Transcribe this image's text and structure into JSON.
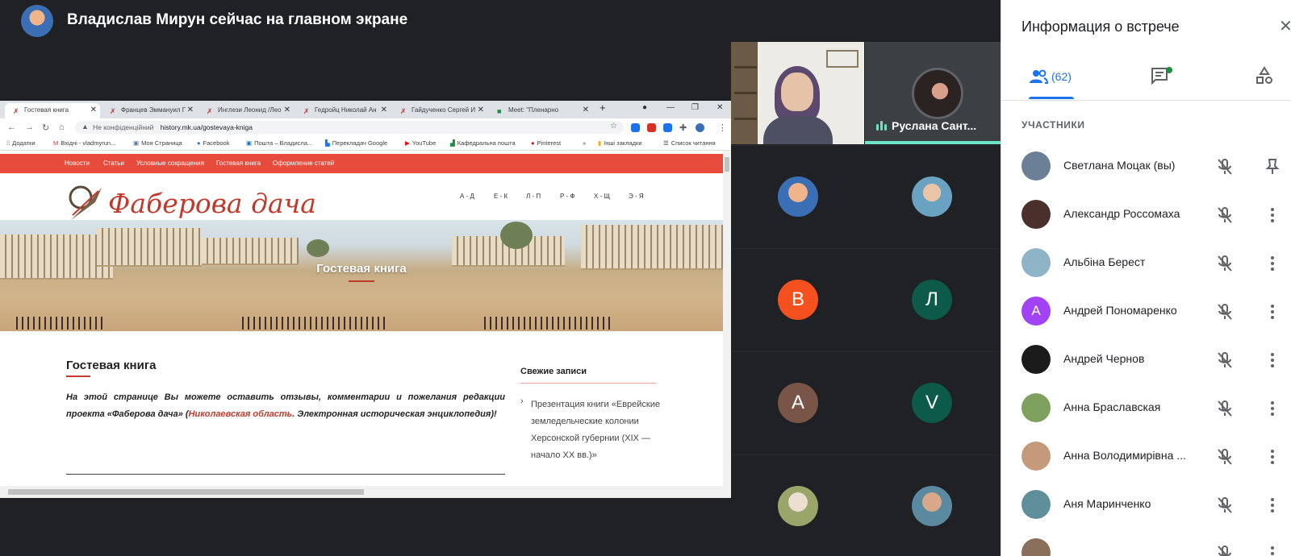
{
  "meeting": {
    "presenter_text": "Владислав Мирун сейчас на главном экране"
  },
  "browser": {
    "tabs": [
      {
        "label": "Гостевая книга",
        "active": true
      },
      {
        "label": "Францев Эммануил Г",
        "active": false
      },
      {
        "label": "Инглези Леонид /Лео",
        "active": false
      },
      {
        "label": "Гедройц Николай Ан",
        "active": false
      },
      {
        "label": "Гайдученко Сергей И",
        "active": false
      },
      {
        "label": "Meet: \"Пленарно",
        "active": false
      }
    ],
    "new_tab": "+",
    "security_label": "Не конфіденційний",
    "url": "history.mk.ua/gostevaya-kniga",
    "bookmarks": [
      {
        "label": "Додатки",
        "icon": "apps-icon"
      },
      {
        "label": "Вхідні - vladmyrun...",
        "icon": "gmail-icon"
      },
      {
        "label": "Моя Страница",
        "icon": "vk-icon"
      },
      {
        "label": "Facebook",
        "icon": "facebook-icon"
      },
      {
        "label": "Пошта – Владисла...",
        "icon": "outlook-icon"
      },
      {
        "label": "Перекладач Google",
        "icon": "translate-icon"
      },
      {
        "label": "YouTube",
        "icon": "youtube-icon"
      },
      {
        "label": "Кафедральна пошта",
        "icon": "mail-icon"
      },
      {
        "label": "Pinterest",
        "icon": "pinterest-icon"
      },
      {
        "label": "»",
        "icon": "more-icon"
      },
      {
        "label": "Інші закладки",
        "icon": "folder-icon"
      },
      {
        "label": "Список читання",
        "icon": "reading-list-icon"
      }
    ]
  },
  "site": {
    "nav": [
      "Новости",
      "Статьи",
      "Условные сокращения",
      "Гостевая книга",
      "Оформление статей"
    ],
    "logo_text": "Фаберова дача",
    "alpha_nav": [
      "А - Д",
      "Е - К",
      "Л - П",
      "Р - Ф",
      "Х - Щ",
      "Э - Я"
    ],
    "hero_title": "Гостевая книга",
    "content_title": "Гостевая книга",
    "content_body_1": "На этой странице Вы можете оставить отзывы, комментарии и пожелания редакции проекта «Фаберова дача» (",
    "content_link": "Николаевская область",
    "content_body_2": ". Электронная историческая энциклопедия)!",
    "sidebar_title": "Свежие записи",
    "sidebar_entry": "Презентация книги «Еврейские земледельческие колонии Херсонской губернии (XIX — начало XX вв.)»"
  },
  "tiles": {
    "speaker_name": "Руслана Сант...",
    "grid": [
      {
        "letter": "",
        "color": "#3b6fb5",
        "photo": true
      },
      {
        "letter": "",
        "color": "#6aa3c2",
        "photo": true
      },
      {
        "letter": "В",
        "color": "#f4511e",
        "photo": false
      },
      {
        "letter": "Л",
        "color": "#0b5a4a",
        "photo": false
      },
      {
        "letter": "А",
        "color": "#795548",
        "photo": false
      },
      {
        "letter": "V",
        "color": "#0b5a4a",
        "photo": false
      },
      {
        "letter": "",
        "color": "#9aa56a",
        "photo": true
      },
      {
        "letter": "",
        "color": "#5b8aa0",
        "photo": true
      }
    ]
  },
  "panel": {
    "title": "Информация о встрече",
    "people_count": "(62)",
    "section_label": "УЧАСТНИКИ",
    "participants": [
      {
        "name": "Светлана Моцак (вы)",
        "initial": "",
        "color": "#6b7f96",
        "action": "pin"
      },
      {
        "name": "Александр Россомаха",
        "initial": "",
        "color": "#4a2f2a",
        "action": "more"
      },
      {
        "name": "Альбіна Берест",
        "initial": "",
        "color": "#8fb4c8",
        "action": "more"
      },
      {
        "name": "Андрей Пономаренко",
        "initial": "А",
        "color": "#a142f4",
        "action": "more"
      },
      {
        "name": "Андрей Чернов",
        "initial": "",
        "color": "#1b1b1b",
        "action": "more"
      },
      {
        "name": "Анна Браславская",
        "initial": "",
        "color": "#7ea25d",
        "action": "more"
      },
      {
        "name": "Анна Володимирівна ...",
        "initial": "",
        "color": "#c49a7a",
        "action": "more"
      },
      {
        "name": "Аня Маринченко",
        "initial": "",
        "color": "#5f8f9b",
        "action": "more"
      },
      {
        "name": "",
        "initial": "",
        "color": "#8a6f5a",
        "action": "more"
      }
    ]
  }
}
